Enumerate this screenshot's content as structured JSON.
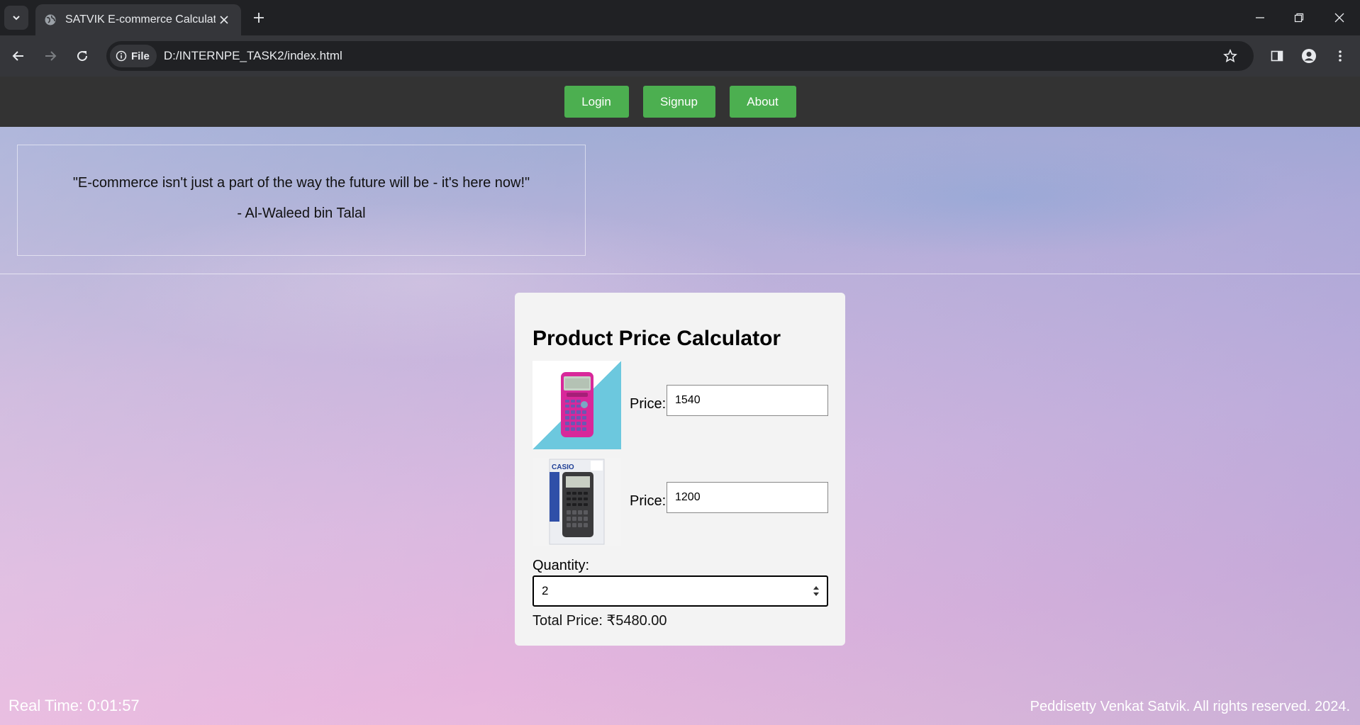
{
  "browser": {
    "tab_title": "SATVIK E-commerce Calculator",
    "chip_label": "File",
    "url": "D:/INTERNPE_TASK2/index.html"
  },
  "navbar": {
    "login": "Login",
    "signup": "Signup",
    "about": "About"
  },
  "quote": {
    "text": "\"E-commerce isn't just a part of the way the future will be - it's here now!\"",
    "author": "- Al-Waleed bin Talal"
  },
  "calculator": {
    "title": "Product Price Calculator",
    "products": [
      {
        "price_label": "Price:",
        "price_value": "1540"
      },
      {
        "price_label": "Price:",
        "price_value": "1200"
      }
    ],
    "product2_brand": "CASIO",
    "quantity_label": "Quantity:",
    "quantity_value": "2",
    "total_text": "Total Price: ₹5480.00"
  },
  "footer": {
    "real_time": "Real Time: 0:01:57",
    "copyright": "Peddisetty Venkat Satvik. All rights reserved. 2024."
  }
}
